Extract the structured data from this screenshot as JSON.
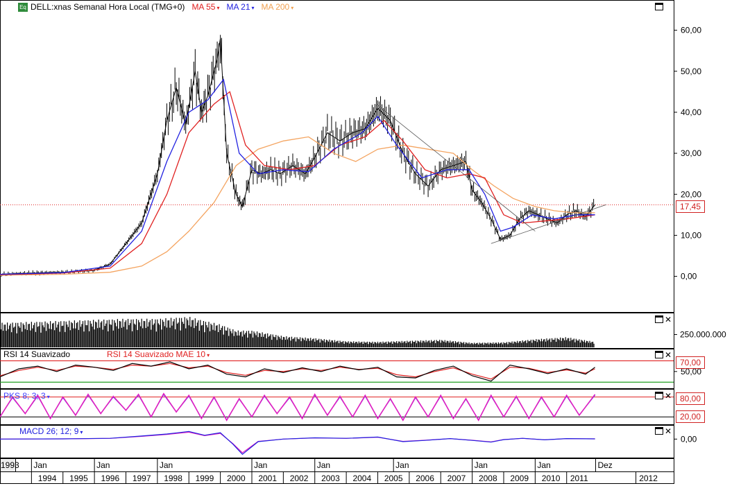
{
  "header": {
    "icon_text": "Eq",
    "title": "DELL:xnas Semanal Hora Local (TMG+0)",
    "ma_items": [
      {
        "label": "MA 55",
        "color": "#e02020"
      },
      {
        "label": "MA 21",
        "color": "#2020e0"
      },
      {
        "label": "MA 200",
        "color": "#f0a050"
      }
    ]
  },
  "colors": {
    "price": "#000000",
    "ma55": "#e02020",
    "ma21": "#2020e0",
    "ma200": "#f4a460",
    "volume": "#000000",
    "rsi": "#000000",
    "rsi_ma": "#e02020",
    "pks_k": "#e020c0",
    "pks_d": "#4040ff",
    "level_line": "#e02020",
    "green_line": "#20a020"
  },
  "chart_data": [
    {
      "type": "line",
      "title": "DELL:xnas Semanal Hora Local (TMG+0)",
      "x_unit": "year",
      "ylim": [
        -7,
        65
      ],
      "y_ticks": [
        "60,00",
        "50,00",
        "40,00",
        "30,00",
        "20,00",
        "10,00",
        "0,00"
      ],
      "y_tick_values": [
        60,
        50,
        40,
        30,
        20,
        10,
        0
      ],
      "last_price": "17,45",
      "last_price_value": 17.45,
      "series": [
        {
          "name": "DELL",
          "x": [
            1993.0,
            1994.0,
            1995.0,
            1995.5,
            1996.0,
            1996.5,
            1997.0,
            1997.5,
            1998.0,
            1998.3,
            1998.6,
            1998.9,
            1999.2,
            1999.4,
            1999.6,
            1999.9,
            2000.0,
            2000.2,
            2000.5,
            2000.7,
            2001.0,
            2001.3,
            2001.6,
            2001.9,
            2002.3,
            2002.7,
            2003.0,
            2003.4,
            2003.8,
            2004.2,
            2004.6,
            2005.0,
            2005.4,
            2005.8,
            2006.2,
            2006.6,
            2007.0,
            2007.4,
            2007.8,
            2008.0,
            2008.3,
            2008.6,
            2008.9,
            2009.2,
            2009.5,
            2009.8,
            2010.1,
            2010.4,
            2010.7,
            2011.0,
            2011.3,
            2011.6,
            2011.9
          ],
          "values": [
            0.5,
            0.8,
            1.0,
            1.2,
            1.5,
            3.0,
            8.0,
            13.0,
            25.0,
            38.0,
            46.0,
            37.0,
            50.0,
            40.0,
            44.0,
            53.0,
            58.0,
            30.0,
            20.0,
            17.0,
            26.0,
            25.0,
            26.0,
            25.0,
            27.0,
            25.0,
            29.0,
            35.0,
            33.0,
            35.0,
            36.0,
            41.0,
            38.0,
            30.0,
            25.0,
            22.0,
            26.0,
            27.0,
            28.0,
            21.0,
            18.0,
            14.0,
            9.0,
            10.0,
            14.0,
            16.0,
            15.0,
            14.0,
            13.0,
            15.0,
            16.0,
            14.5,
            17.45
          ]
        },
        {
          "name": "MA 21",
          "x": [
            1993.0,
            1995.0,
            1996.5,
            1997.5,
            1998.3,
            1999.0,
            1999.6,
            2000.1,
            2000.6,
            2001.2,
            2002.0,
            2002.8,
            2003.6,
            2004.5,
            2005.0,
            2005.6,
            2006.4,
            2007.2,
            2007.9,
            2008.4,
            2008.9,
            2009.3,
            2009.9,
            2010.6,
            2011.3,
            2011.9
          ],
          "values": [
            0.5,
            0.9,
            2.5,
            11.0,
            28.0,
            40.0,
            43.0,
            48.0,
            30.0,
            25.0,
            26.0,
            25.5,
            31.0,
            35.0,
            39.0,
            32.0,
            24.0,
            26.0,
            26.0,
            20.0,
            11.0,
            12.0,
            15.0,
            14.0,
            15.0,
            15.0
          ]
        },
        {
          "name": "MA 55",
          "x": [
            1993.0,
            1995.0,
            1996.5,
            1997.5,
            1998.3,
            1999.0,
            1999.8,
            2000.3,
            2000.8,
            2001.4,
            2002.2,
            2003.0,
            2003.8,
            2004.6,
            2005.2,
            2005.8,
            2006.5,
            2007.2,
            2007.9,
            2008.4,
            2009.0,
            2009.6,
            2010.3,
            2011.0,
            2011.9
          ],
          "values": [
            0.4,
            0.8,
            2.0,
            8.0,
            20.0,
            35.0,
            42.0,
            45.0,
            32.0,
            27.0,
            26.0,
            27.0,
            32.0,
            34.0,
            38.0,
            33.0,
            26.0,
            24.0,
            25.0,
            24.0,
            15.0,
            13.0,
            13.5,
            14.0,
            15.0
          ]
        },
        {
          "name": "MA 200",
          "x": [
            1993.0,
            1995.0,
            1996.5,
            1997.5,
            1998.3,
            1999.0,
            1999.8,
            2000.5,
            2001.2,
            2002.0,
            2002.8,
            2003.6,
            2004.3,
            2005.0,
            2005.8,
            2006.6,
            2007.4,
            2008.0,
            2008.7,
            2009.3,
            2010.0,
            2010.6,
            2011.2,
            2011.9
          ],
          "values": [
            0.3,
            0.5,
            1.0,
            2.5,
            6.0,
            11.0,
            18.0,
            27.0,
            31.0,
            33.0,
            34.0,
            30.0,
            28.0,
            31.0,
            32.0,
            31.0,
            30.0,
            26.0,
            22.0,
            19.0,
            17.0,
            16.0,
            15.5,
            15.5
          ]
        }
      ],
      "trendlines": [
        {
          "x": [
            2004.95,
            2010.0
          ],
          "values": [
            42.0,
            11.0
          ]
        },
        {
          "x": [
            2008.6,
            2012.25
          ],
          "values": [
            8.0,
            17.45
          ]
        }
      ]
    },
    {
      "type": "bar",
      "title": "Volume",
      "y_ticks": [
        "250.000.000"
      ],
      "y_tick_values": [
        250000000
      ],
      "ylim": [
        0,
        650000000
      ],
      "x": [
        1993.0,
        1994.0,
        1995.0,
        1996.0,
        1997.0,
        1997.5,
        1998.0,
        1998.5,
        1999.0,
        1999.5,
        2000.0,
        2000.5,
        2001.0,
        2002.0,
        2003.0,
        2004.0,
        2005.0,
        2006.0,
        2007.0,
        2008.0,
        2009.0,
        2010.0,
        2011.0,
        2011.9
      ],
      "values": [
        480000000,
        500000000,
        520000000,
        540000000,
        560000000,
        560000000,
        560000000,
        580000000,
        600000000,
        520000000,
        450000000,
        330000000,
        330000000,
        220000000,
        180000000,
        120000000,
        110000000,
        130000000,
        150000000,
        90000000,
        100000000,
        160000000,
        200000000,
        110000000
      ]
    },
    {
      "type": "line",
      "title": "RSI 14 Suavizado",
      "legend": [
        "RSI 14 Suavizado",
        "RSI 14 Suavizado MAE 10"
      ],
      "ylim": [
        20,
        90
      ],
      "y_ticks": [
        "70,00",
        "50,00"
      ],
      "y_tick_values": [
        70,
        50
      ],
      "levels": [
        70,
        30
      ],
      "x": [
        1993.0,
        1993.6,
        1994.2,
        1994.8,
        1995.4,
        1996.0,
        1996.6,
        1997.2,
        1997.8,
        1998.4,
        1999.0,
        1999.6,
        2000.2,
        2000.8,
        2001.4,
        2002.0,
        2002.6,
        2003.2,
        2003.8,
        2004.4,
        2005.0,
        2005.6,
        2006.2,
        2006.8,
        2007.4,
        2008.0,
        2008.6,
        2009.2,
        2009.8,
        2010.4,
        2011.0,
        2011.6,
        2011.9
      ],
      "series": [
        {
          "name": "RSI 14 Suavizado",
          "values": [
            40,
            55,
            60,
            50,
            62,
            58,
            52,
            65,
            60,
            68,
            55,
            62,
            45,
            40,
            55,
            48,
            57,
            50,
            60,
            53,
            58,
            40,
            38,
            52,
            60,
            42,
            32,
            62,
            55,
            46,
            55,
            45,
            58
          ]
        },
        {
          "name": "RSI 14 Suavizado MAE 10",
          "values": [
            42,
            52,
            58,
            52,
            60,
            58,
            54,
            62,
            60,
            65,
            57,
            60,
            48,
            43,
            52,
            50,
            55,
            52,
            58,
            54,
            56,
            44,
            40,
            50,
            57,
            45,
            36,
            58,
            56,
            48,
            53,
            47,
            55
          ]
        }
      ]
    },
    {
      "type": "line",
      "title": "PKS 8; 3; 3",
      "ylim": [
        0,
        100
      ],
      "y_ticks": [
        "80,00",
        "20,00"
      ],
      "y_tick_values": [
        80,
        20
      ],
      "levels": [
        80,
        20
      ],
      "x": [
        1993.0,
        1993.4,
        1993.8,
        1994.2,
        1994.6,
        1995.0,
        1995.4,
        1995.8,
        1996.2,
        1996.6,
        1997.0,
        1997.4,
        1997.8,
        1998.2,
        1998.6,
        1999.0,
        1999.4,
        1999.8,
        2000.2,
        2000.6,
        2001.0,
        2001.4,
        2001.8,
        2002.2,
        2002.6,
        2003.0,
        2003.4,
        2003.8,
        2004.2,
        2004.6,
        2005.0,
        2005.4,
        2005.8,
        2006.2,
        2006.6,
        2007.0,
        2007.4,
        2007.8,
        2008.2,
        2008.6,
        2009.0,
        2009.4,
        2009.8,
        2010.2,
        2010.6,
        2011.0,
        2011.4,
        2011.9
      ],
      "series": [
        {
          "name": "PKS 8; 3; 3",
          "values": [
            20,
            80,
            30,
            85,
            15,
            80,
            25,
            88,
            30,
            82,
            40,
            88,
            20,
            90,
            35,
            85,
            15,
            80,
            10,
            75,
            20,
            85,
            30,
            80,
            15,
            88,
            25,
            82,
            20,
            85,
            15,
            75,
            10,
            80,
            20,
            85,
            15,
            75,
            10,
            85,
            20,
            82,
            15,
            80,
            20,
            85,
            25,
            88
          ]
        }
      ]
    },
    {
      "type": "line",
      "title": "MACD 26; 12; 9",
      "ylim": [
        -7,
        5
      ],
      "y_ticks": [
        "0,00"
      ],
      "y_tick_values": [
        0
      ],
      "x": [
        1993.0,
        1995.0,
        1996.5,
        1997.5,
        1998.3,
        1999.0,
        1999.5,
        2000.0,
        2000.4,
        2000.7,
        2001.2,
        2002.0,
        2003.0,
        2004.0,
        2005.0,
        2005.8,
        2006.5,
        2007.3,
        2008.0,
        2008.6,
        2009.0,
        2009.6,
        2010.3,
        2011.0,
        2011.9
      ],
      "series": [
        {
          "name": "MACD 26; 12; 9",
          "values": [
            0,
            0.1,
            0.3,
            1.2,
            2.0,
            3.0,
            1.5,
            2.5,
            -2.0,
            -6.0,
            -1.0,
            0.0,
            0.5,
            0.3,
            0.8,
            -1.0,
            -0.5,
            0.2,
            -0.5,
            -1.2,
            -0.2,
            0.3,
            -0.3,
            0.2,
            0.1
          ]
        }
      ]
    }
  ],
  "time_axis": {
    "upper": [
      {
        "label": "1993",
        "x": 1993.05,
        "cell": true
      },
      {
        "label": "Jan",
        "x": 1994.0
      },
      {
        "label": "Jan",
        "x": 1996.0
      },
      {
        "label": "Jan",
        "x": 1998.0
      },
      {
        "label": "Jan",
        "x": 2001.0
      },
      {
        "label": "Jan",
        "x": 2003.0
      },
      {
        "label": "Jan",
        "x": 2005.5
      },
      {
        "label": "Jan",
        "x": 2008.0
      },
      {
        "label": "Jan",
        "x": 2010.0
      },
      {
        "label": "Dez",
        "x": 2011.92
      }
    ],
    "years": [
      {
        "label": "1994",
        "x": 1994.0
      },
      {
        "label": "1995",
        "x": 1995.0
      },
      {
        "label": "1996",
        "x": 1996.0
      },
      {
        "label": "1997",
        "x": 1997.0
      },
      {
        "label": "1998",
        "x": 1998.0
      },
      {
        "label": "1999",
        "x": 1999.0
      },
      {
        "label": "2000",
        "x": 2000.0
      },
      {
        "label": "2001",
        "x": 2001.0
      },
      {
        "label": "2002",
        "x": 2002.0
      },
      {
        "label": "2003",
        "x": 2003.0
      },
      {
        "label": "2004",
        "x": 2004.0
      },
      {
        "label": "2005",
        "x": 2005.0
      },
      {
        "label": "2006",
        "x": 2006.0
      },
      {
        "label": "2007",
        "x": 2007.0
      },
      {
        "label": "2008",
        "x": 2008.0
      },
      {
        "label": "2009",
        "x": 2009.0
      },
      {
        "label": "2010",
        "x": 2010.0
      },
      {
        "label": "2011",
        "x": 2011.0
      },
      {
        "label": "2012",
        "x": 2013.2
      }
    ]
  },
  "panes": {
    "rsi_label": "RSI 14 Suavizado",
    "rsi_ma_label": "RSI 14 Suavizado MAE 10",
    "pks_label": "PKS 8; 3; 3",
    "macd_label": "MACD 26; 12; 9",
    "price_tag": "17,45",
    "rsi_tag": "70,00",
    "pks_tag_high": "80,00",
    "pks_tag_low": "20,00"
  },
  "caret": "▾",
  "close_glyph": "✕"
}
